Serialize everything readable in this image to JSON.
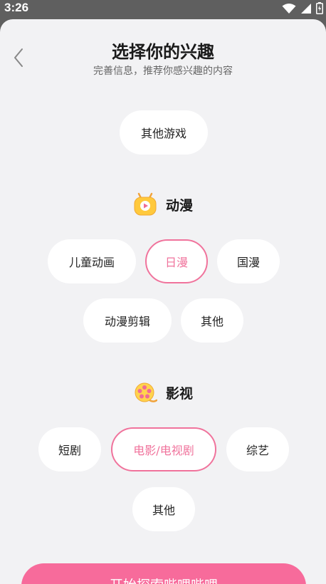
{
  "status_bar": {
    "time": "3:26"
  },
  "header": {
    "title": "选择你的兴趣",
    "subtitle": "完善信息，推荐你感兴趣的内容"
  },
  "games": {
    "chips": [
      {
        "label": "其他游戏",
        "selected": false
      }
    ]
  },
  "anime": {
    "title": "动漫",
    "icon": "tv-icon",
    "chips": [
      {
        "label": "儿童动画",
        "selected": false
      },
      {
        "label": "日漫",
        "selected": true
      },
      {
        "label": "国漫",
        "selected": false
      },
      {
        "label": "动漫剪辑",
        "selected": false
      },
      {
        "label": "其他",
        "selected": false
      }
    ]
  },
  "film": {
    "title": "影视",
    "icon": "film-reel-icon",
    "chips": [
      {
        "label": "短剧",
        "selected": false
      },
      {
        "label": "电影/电视剧",
        "selected": true
      },
      {
        "label": "综艺",
        "selected": false
      },
      {
        "label": "其他",
        "selected": false
      }
    ]
  },
  "cta": {
    "label": "开始探索哔哩哔哩"
  },
  "colors": {
    "accent": "#f0739c",
    "cta": "#f76b9b",
    "background": "#f2f2f4"
  }
}
